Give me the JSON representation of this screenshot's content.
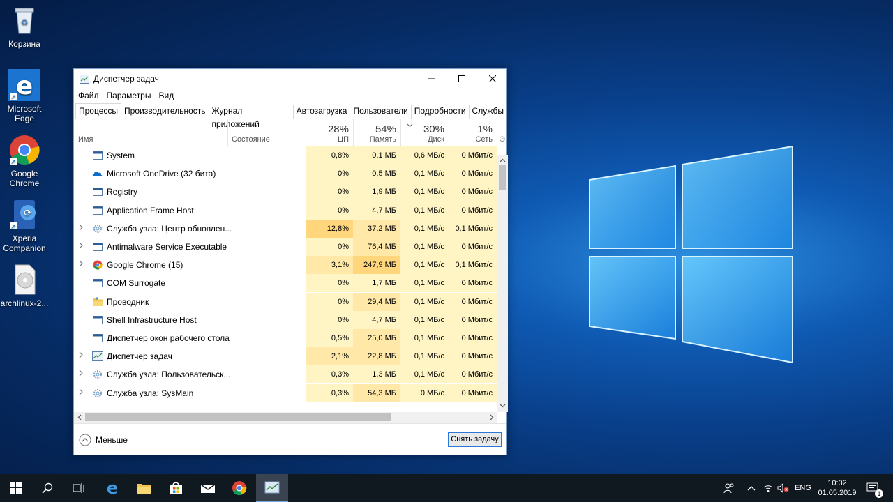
{
  "desktop": {
    "icons": [
      {
        "label": "Корзина",
        "icon": "recycle-bin-icon"
      },
      {
        "label": "Microsoft Edge",
        "icon": "edge-icon"
      },
      {
        "label": "Google Chrome",
        "icon": "chrome-icon"
      },
      {
        "label": "Xperia Companion",
        "icon": "xperia-icon"
      },
      {
        "label": "archlinux-2...",
        "icon": "disc-image-icon"
      }
    ]
  },
  "window": {
    "title": "Диспетчер задач",
    "menu": [
      "Файл",
      "Параметры",
      "Вид"
    ],
    "tabs": [
      "Процессы",
      "Производительность",
      "Журнал приложений",
      "Автозагрузка",
      "Пользователи",
      "Подробности",
      "Службы"
    ],
    "active_tab": "Процессы",
    "columns": {
      "name": "Имя",
      "state": "Состояние",
      "cpu": {
        "percent": "28%",
        "label": "ЦП"
      },
      "memory": {
        "percent": "54%",
        "label": "Память"
      },
      "disk": {
        "percent": "30%",
        "label": "Диск"
      },
      "network": {
        "percent": "1%",
        "label": "Сеть"
      },
      "overflow": "Э"
    },
    "processes": [
      {
        "name": "System",
        "expandable": false,
        "icon": "app-window-icon",
        "cpu": "0,8%",
        "memory": "0,1 МБ",
        "disk": "0,6 МБ/с",
        "network": "0 Мбит/с"
      },
      {
        "name": "Microsoft OneDrive (32 бита)",
        "expandable": false,
        "icon": "onedrive-icon",
        "cpu": "0%",
        "memory": "0,5 МБ",
        "disk": "0,1 МБ/с",
        "network": "0 Мбит/с"
      },
      {
        "name": "Registry",
        "expandable": false,
        "icon": "app-window-icon",
        "cpu": "0%",
        "memory": "1,9 МБ",
        "disk": "0,1 МБ/с",
        "network": "0 Мбит/с"
      },
      {
        "name": "Application Frame Host",
        "expandable": false,
        "icon": "app-window-icon",
        "cpu": "0%",
        "memory": "4,7 МБ",
        "disk": "0,1 МБ/с",
        "network": "0 Мбит/с"
      },
      {
        "name": "Служба узла: Центр обновлен...",
        "expandable": true,
        "icon": "gear-icon",
        "cpu": "12,8%",
        "memory": "37,2 МБ",
        "disk": "0,1 МБ/с",
        "network": "0,1 Мбит/с"
      },
      {
        "name": "Antimalware Service Executable",
        "expandable": true,
        "icon": "app-window-icon",
        "cpu": "0%",
        "memory": "76,4 МБ",
        "disk": "0,1 МБ/с",
        "network": "0 Мбит/с"
      },
      {
        "name": "Google Chrome (15)",
        "expandable": true,
        "icon": "chrome-icon",
        "cpu": "3,1%",
        "memory": "247,9 МБ",
        "disk": "0,1 МБ/с",
        "network": "0,1 Мбит/с"
      },
      {
        "name": "COM Surrogate",
        "expandable": false,
        "icon": "app-window-icon",
        "cpu": "0%",
        "memory": "1,7 МБ",
        "disk": "0,1 МБ/с",
        "network": "0 Мбит/с"
      },
      {
        "name": "Проводник",
        "expandable": false,
        "icon": "folder-icon",
        "cpu": "0%",
        "memory": "29,4 МБ",
        "disk": "0,1 МБ/с",
        "network": "0 Мбит/с"
      },
      {
        "name": "Shell Infrastructure Host",
        "expandable": false,
        "icon": "app-window-icon",
        "cpu": "0%",
        "memory": "4,7 МБ",
        "disk": "0,1 МБ/с",
        "network": "0 Мбит/с"
      },
      {
        "name": "Диспетчер окон рабочего стола",
        "expandable": false,
        "icon": "app-window-icon",
        "cpu": "0,5%",
        "memory": "25,0 МБ",
        "disk": "0,1 МБ/с",
        "network": "0 Мбит/с"
      },
      {
        "name": "Диспетчер задач",
        "expandable": true,
        "icon": "task-manager-icon",
        "cpu": "2,1%",
        "memory": "22,8 МБ",
        "disk": "0,1 МБ/с",
        "network": "0 Мбит/с"
      },
      {
        "name": "Служба узла: Пользовательск...",
        "expandable": true,
        "icon": "gear-icon",
        "cpu": "0,3%",
        "memory": "1,3 МБ",
        "disk": "0,1 МБ/с",
        "network": "0 Мбит/с"
      },
      {
        "name": "Служба узла: SysMain",
        "expandable": true,
        "icon": "gear-icon",
        "cpu": "0,3%",
        "memory": "54,3 МБ",
        "disk": "0 МБ/с",
        "network": "0 Мбит/с"
      }
    ],
    "footer": {
      "less_label": "Меньше",
      "end_task_label": "Снять задачу"
    }
  },
  "taskbar": {
    "language": "ENG",
    "time": "10:02",
    "date": "01.05.2019",
    "notifications_count": "1"
  },
  "colors": {
    "cell_light": "#fff4c4",
    "cell_mid": "#ffe8a8",
    "cell_strong": "#ffd67c",
    "taskbar": "#101820"
  }
}
